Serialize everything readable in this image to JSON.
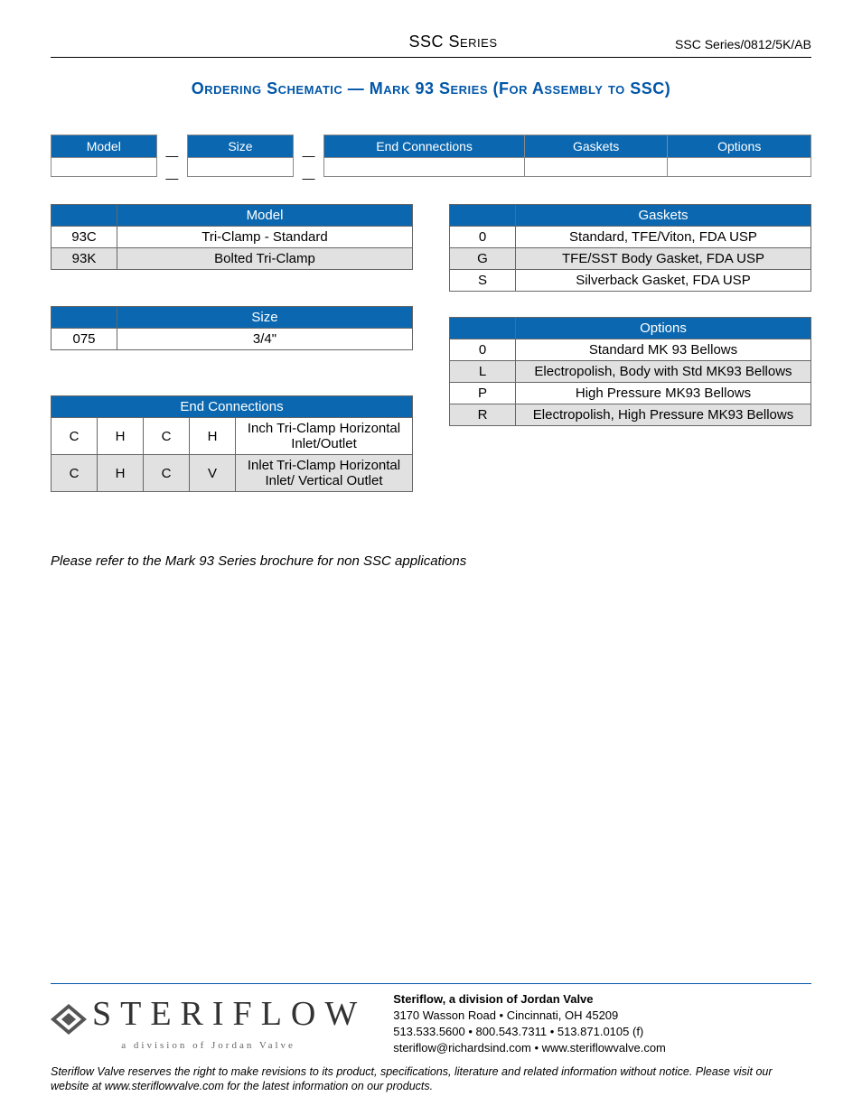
{
  "header": {
    "center": "SSC Series",
    "right": "SSC Series/0812/5K/AB"
  },
  "title": "Ordering Schematic — Mark 93 Series (For Assembly to SSC)",
  "schematic_cols": {
    "model": "Model",
    "size": "Size",
    "endconn": "End Connections",
    "gaskets": "Gaskets",
    "options": "Options"
  },
  "tables": {
    "model": {
      "header": "Model",
      "rows": [
        {
          "code": "93C",
          "desc": "Tri-Clamp - Standard"
        },
        {
          "code": "93K",
          "desc": "Bolted Tri-Clamp"
        }
      ]
    },
    "size": {
      "header": "Size",
      "rows": [
        {
          "code": "075",
          "desc": "3/4\""
        }
      ]
    },
    "endconn": {
      "header": "End Connections",
      "rows": [
        {
          "a": "C",
          "b": "H",
          "c": "C",
          "d": "H",
          "desc": "Inch Tri-Clamp Horizontal Inlet/Outlet"
        },
        {
          "a": "C",
          "b": "H",
          "c": "C",
          "d": "V",
          "desc": "Inlet Tri-Clamp Horizontal Inlet/ Vertical Outlet"
        }
      ]
    },
    "gaskets": {
      "header": "Gaskets",
      "rows": [
        {
          "code": "0",
          "desc": "Standard, TFE/Viton, FDA USP"
        },
        {
          "code": "G",
          "desc": "TFE/SST Body Gasket, FDA USP"
        },
        {
          "code": "S",
          "desc": "Silverback Gasket, FDA USP"
        }
      ]
    },
    "options": {
      "header": "Options",
      "rows": [
        {
          "code": "0",
          "desc": "Standard MK 93 Bellows"
        },
        {
          "code": "L",
          "desc": "Electropolish, Body with Std MK93 Bellows"
        },
        {
          "code": "P",
          "desc": "High Pressure MK93 Bellows"
        },
        {
          "code": "R",
          "desc": "Electropolish, High Pressure MK93 Bellows"
        }
      ]
    }
  },
  "note": "Please refer to the Mark 93 Series brochure for non SSC applications",
  "footer": {
    "logo_word": "STERIFLOW",
    "logo_sub": "a  division  of  Jordan  Valve",
    "line1": "Steriflow, a division of Jordan Valve",
    "line2": "3170 Wasson Road  •  Cincinnati, OH  45209",
    "line3": "513.533.5600  •  800.543.7311  •  513.871.0105 (f)",
    "line4": "steriflow@richardsind.com  •  www.steriflowvalve.com",
    "disclaimer": "Steriflow Valve reserves the right to make revisions to its product, specifications, literature and related information without notice. Please visit our website at www.steriflowvalve.com for the latest information on our products."
  }
}
